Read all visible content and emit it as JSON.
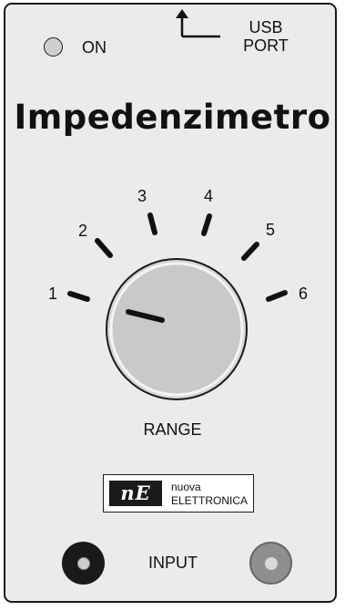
{
  "panel": {
    "led_label": "ON",
    "usb_label_line1": "USB",
    "usb_label_line2": "PORT",
    "title": "Impedenzimetro"
  },
  "range_selector": {
    "label": "RANGE",
    "positions": [
      "1",
      "2",
      "3",
      "4",
      "5",
      "6"
    ],
    "selected": "1"
  },
  "brand": {
    "logo": "nE",
    "line1": "nuova",
    "line2": "ELETTRONICA"
  },
  "input": {
    "label": "INPUT"
  },
  "colors": {
    "panel_background": "#ebebeb",
    "outline": "#1a1a1a",
    "knob_face": "#cdcdcd",
    "led_off": "#cfcfcf",
    "jack_black": "#1a1a1a",
    "jack_grey": "#8f8f8f"
  },
  "icons": {
    "usb_arrow": "usb-arrow-icon"
  }
}
